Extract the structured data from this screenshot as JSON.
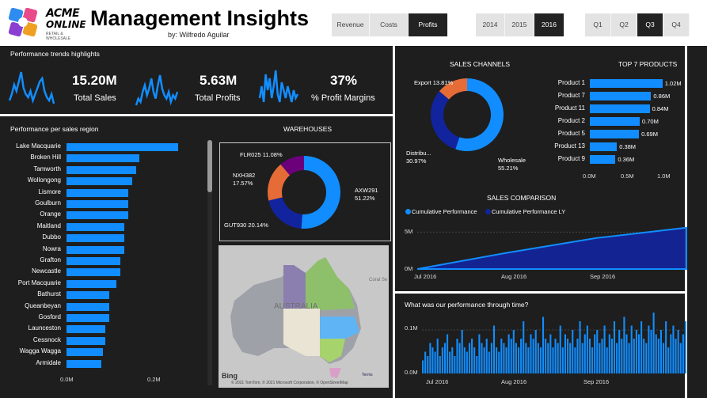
{
  "header": {
    "logo_line1": "ACME",
    "logo_line2": "ONLINE",
    "logo_tagline": "RETAIL & WHOLESALE",
    "title": "Management Insights",
    "byline": "by: Wilfredo Aguilar",
    "metric_buttons": [
      {
        "label": "Revenue",
        "active": false
      },
      {
        "label": "Costs",
        "active": false
      },
      {
        "label": "Profits",
        "active": true
      }
    ],
    "year_buttons": [
      {
        "label": "2014",
        "active": false
      },
      {
        "label": "2015",
        "active": false
      },
      {
        "label": "2016",
        "active": true
      }
    ],
    "quarter_buttons": [
      {
        "label": "Q1",
        "active": false
      },
      {
        "label": "Q2",
        "active": false
      },
      {
        "label": "Q3",
        "active": true
      },
      {
        "label": "Q4",
        "active": false
      }
    ]
  },
  "trends": {
    "title": "Performance trends highlights",
    "kpis": [
      {
        "value": "15.20M",
        "label": "Total Sales"
      },
      {
        "value": "5.63M",
        "label": "Total Profits"
      },
      {
        "value": "37%",
        "label": "% Profit Margins"
      }
    ]
  },
  "regions": {
    "title": "Performance per sales region",
    "axis": [
      "0.0M",
      "0.2M"
    ],
    "chart_data": {
      "type": "bar",
      "orientation": "horizontal",
      "categories": [
        "Lake Macquarie",
        "Broken Hill",
        "Tamworth",
        "Wollongong",
        "Lismore",
        "Goulburn",
        "Orange",
        "Maitland",
        "Dubbo",
        "Nowra",
        "Grafton",
        "Newcastle",
        "Port Macquarie",
        "Bathurst",
        "Queanbeyan",
        "Gosford",
        "Launceston",
        "Cessnock",
        "Wagga Wagga",
        "Armidale"
      ],
      "values": [
        0.29,
        0.19,
        0.18,
        0.17,
        0.16,
        0.16,
        0.16,
        0.15,
        0.15,
        0.15,
        0.14,
        0.14,
        0.13,
        0.11,
        0.11,
        0.11,
        0.1,
        0.1,
        0.095,
        0.09
      ],
      "xlim": [
        0,
        0.3
      ],
      "title": "Performance per sales region"
    }
  },
  "warehouses": {
    "title": "WAREHOUSES",
    "chart_data": {
      "type": "pie",
      "donut": true,
      "categories": [
        "AXW291",
        "GUT930",
        "NXH382",
        "FLR025"
      ],
      "values": [
        51.22,
        20.14,
        17.57,
        11.08
      ],
      "labels": [
        "AXW291\n51.22%",
        "GUT930 20.14%",
        "NXH382\n17.57%",
        "FLR025 11.08%"
      ],
      "colors": [
        "#118dff",
        "#12239e",
        "#e66c37",
        "#6b007b"
      ]
    }
  },
  "map": {
    "country_label": "AUSTRALIA",
    "sea_label": "Coral Se",
    "brand": "Bing",
    "attribution": "© 2021 TomTom, © 2021 Microsoft Corporation, © OpenStreetMap",
    "terms": "Terms"
  },
  "sales_channels": {
    "title": "SALES CHANNELS",
    "chart_data": {
      "type": "pie",
      "donut": true,
      "categories": [
        "Wholesale",
        "Distributor",
        "Export"
      ],
      "values": [
        55.21,
        30.97,
        13.81
      ],
      "labels": [
        "Wholesale\n55.21%",
        "Distribu...\n30.97%",
        "Export 13.81%"
      ],
      "colors": [
        "#118dff",
        "#12239e",
        "#e66c37"
      ]
    }
  },
  "top_products": {
    "title": "TOP 7 PRODUCTS",
    "axis": [
      "0.0M",
      "0.5M",
      "1.0M"
    ],
    "chart_data": {
      "type": "bar",
      "orientation": "horizontal",
      "categories": [
        "Product 1",
        "Product 7",
        "Product 11",
        "Product 2",
        "Product 5",
        "Product 13",
        "Product 9"
      ],
      "values": [
        1.02,
        0.86,
        0.84,
        0.7,
        0.69,
        0.38,
        0.36
      ],
      "data_labels": [
        "1.02M",
        "0.86M",
        "0.84M",
        "0.70M",
        "0.69M",
        "0.38M",
        "0.36M"
      ],
      "xlim": [
        0,
        1.2
      ],
      "title": "TOP 7 PRODUCTS"
    }
  },
  "sales_comparison": {
    "title": "SALES COMPARISON",
    "legend": [
      "Cumulative Performance",
      "Cumulative Performance LY"
    ],
    "y_ticks": [
      "5M",
      "0M"
    ],
    "x_ticks": [
      "Jul 2016",
      "Aug 2016",
      "Sep 2016"
    ],
    "colors": {
      "current": "#118dff",
      "ly": "#12239e"
    },
    "chart_data": {
      "type": "area",
      "x": [
        "Jul 2016",
        "Aug 2016",
        "Sep 2016",
        "end of Sep 2016"
      ],
      "series": [
        {
          "name": "Cumulative Performance",
          "values": [
            0,
            2.2,
            4.2,
            5.6
          ]
        },
        {
          "name": "Cumulative Performance LY",
          "values": [
            0,
            2.1,
            4.1,
            5.5
          ]
        }
      ],
      "ylim": [
        0,
        6
      ]
    }
  },
  "through_time": {
    "title": "What was our performance through time?",
    "y_ticks": [
      "0.1M",
      "0.0M"
    ],
    "x_ticks": [
      "Jul 2016",
      "Aug 2016",
      "Sep 2016"
    ],
    "chart_data": {
      "type": "bar",
      "x_range": [
        "Jul 2016",
        "Sep 2016"
      ],
      "values": [
        0.03,
        0.05,
        0.04,
        0.07,
        0.06,
        0.05,
        0.08,
        0.04,
        0.06,
        0.07,
        0.09,
        0.05,
        0.06,
        0.04,
        0.08,
        0.07,
        0.1,
        0.06,
        0.05,
        0.07,
        0.08,
        0.06,
        0.04,
        0.09,
        0.07,
        0.06,
        0.08,
        0.05,
        0.07,
        0.11,
        0.06,
        0.05,
        0.08,
        0.07,
        0.06,
        0.09,
        0.08,
        0.1,
        0.07,
        0.06,
        0.08,
        0.12,
        0.07,
        0.06,
        0.09,
        0.08,
        0.1,
        0.07,
        0.06,
        0.13,
        0.08,
        0.07,
        0.09,
        0.06,
        0.08,
        0.07,
        0.11,
        0.06,
        0.09,
        0.08,
        0.07,
        0.1,
        0.06,
        0.08,
        0.12,
        0.07,
        0.09,
        0.11,
        0.08,
        0.06,
        0.09,
        0.1,
        0.07,
        0.08,
        0.11,
        0.06,
        0.09,
        0.08,
        0.12,
        0.07,
        0.1,
        0.08,
        0.13,
        0.09,
        0.07,
        0.11,
        0.08,
        0.1,
        0.09,
        0.12,
        0.08,
        0.07,
        0.11,
        0.1,
        0.14,
        0.09,
        0.08,
        0.1,
        0.07,
        0.12,
        0.06,
        0.09,
        0.11,
        0.08,
        0.1,
        0.07,
        0.09,
        0.12
      ],
      "ylim": [
        0,
        0.14
      ]
    }
  },
  "sparklines": [
    [
      3,
      5,
      8,
      6,
      9,
      12,
      7,
      5,
      4,
      6,
      3,
      5,
      7,
      9,
      10,
      6,
      4,
      3,
      5,
      2
    ],
    [
      2,
      4,
      3,
      6,
      8,
      5,
      7,
      10,
      6,
      4,
      8,
      11,
      7,
      5,
      4,
      6,
      3,
      5,
      4,
      6
    ],
    [
      6,
      9,
      5,
      12,
      8,
      11,
      6,
      9,
      13,
      7,
      5,
      10,
      8,
      6,
      9,
      7,
      5,
      8,
      6,
      7
    ]
  ]
}
